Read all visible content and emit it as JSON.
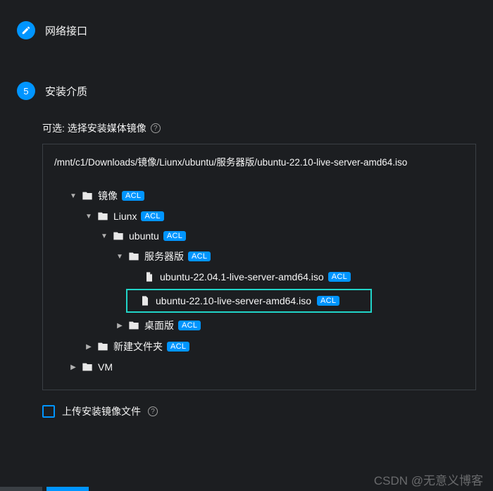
{
  "section_network": {
    "label": "网络接口"
  },
  "section_install": {
    "step_number": "5",
    "label": "安装介质",
    "field_label": "可选: 选择安装媒体镜像",
    "upload_label": "上传安装镜像文件"
  },
  "badges": {
    "acl": "ACL"
  },
  "path": "/mnt/c1/Downloads/镜像/Liunx/ubuntu/服务器版/ubuntu-22.10-live-server-amd64.iso",
  "tree": {
    "root": {
      "label": "镜像",
      "children": {
        "liunx": {
          "label": "Liunx",
          "children": {
            "ubuntu": {
              "label": "ubuntu",
              "children": {
                "server": {
                  "label": "服务器版",
                  "files": {
                    "f1": "ubuntu-22.04.1-live-server-amd64.iso",
                    "f2": "ubuntu-22.10-live-server-amd64.iso"
                  }
                },
                "desktop": {
                  "label": "桌面版"
                }
              }
            }
          }
        },
        "newfolder": {
          "label": "新建文件夹"
        }
      }
    },
    "vm": {
      "label": "VM"
    }
  },
  "watermark": "CSDN @无意义博客"
}
